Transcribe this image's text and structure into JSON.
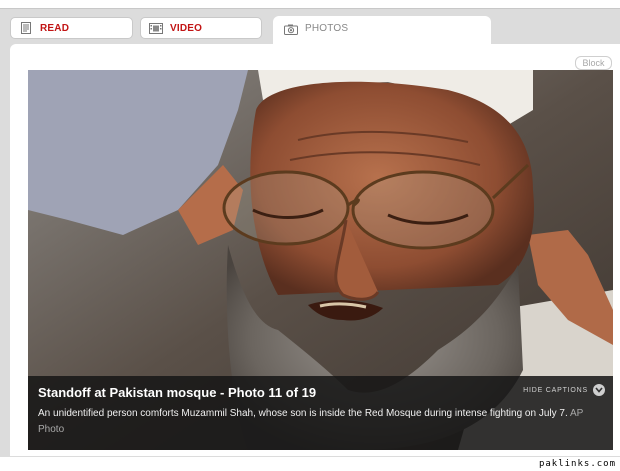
{
  "tabs": [
    {
      "label": "READ",
      "icon": "document-icon"
    },
    {
      "label": "VIDEO",
      "icon": "film-icon"
    },
    {
      "label": "PHOTOS",
      "icon": "camera-icon"
    }
  ],
  "block_label": "Block",
  "photo": {
    "subject": "elderly bearded man in white cap and glasses, weeping, a hand on his shoulder"
  },
  "caption": {
    "title": "Standoff at Pakistan mosque - Photo 11 of 19",
    "hide_label": "HIDE CAPTIONS",
    "description": "An unidentified person comforts Muzammil Shah, whose son is inside the Red Mosque during intense fighting on July 7.",
    "credit": "AP Photo"
  },
  "watermark": "paklinks.com",
  "colors": {
    "tab_active_text": "#c21414",
    "tab_inactive_text": "#888888",
    "frame_bg": "#dcdcdc",
    "caption_bg": "#161616"
  }
}
